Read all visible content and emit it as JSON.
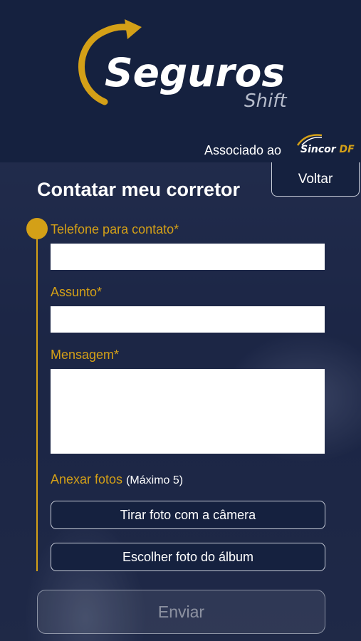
{
  "header": {
    "logo": {
      "main": "Seguros",
      "sub": "Shift"
    },
    "associated_label": "Associado ao",
    "partner_logo": {
      "name": "Sincor",
      "suffix": "DF"
    }
  },
  "nav": {
    "back_label": "Voltar"
  },
  "page": {
    "title": "Contatar meu corretor"
  },
  "form": {
    "phone": {
      "label": "Telefone para contato",
      "required_mark": "*",
      "value": ""
    },
    "subject": {
      "label": "Assunto",
      "required_mark": "*",
      "value": ""
    },
    "message": {
      "label": "Mensagem",
      "required_mark": "*",
      "value": ""
    },
    "attachments": {
      "label": "Anexar fotos",
      "note": "(Máximo 5)",
      "camera_button": "Tirar foto com a câmera",
      "album_button": "Escolher foto do álbum"
    },
    "submit_label": "Enviar"
  },
  "colors": {
    "accent": "#d4a017",
    "header_bg": "#15213f",
    "text": "#ffffff"
  }
}
